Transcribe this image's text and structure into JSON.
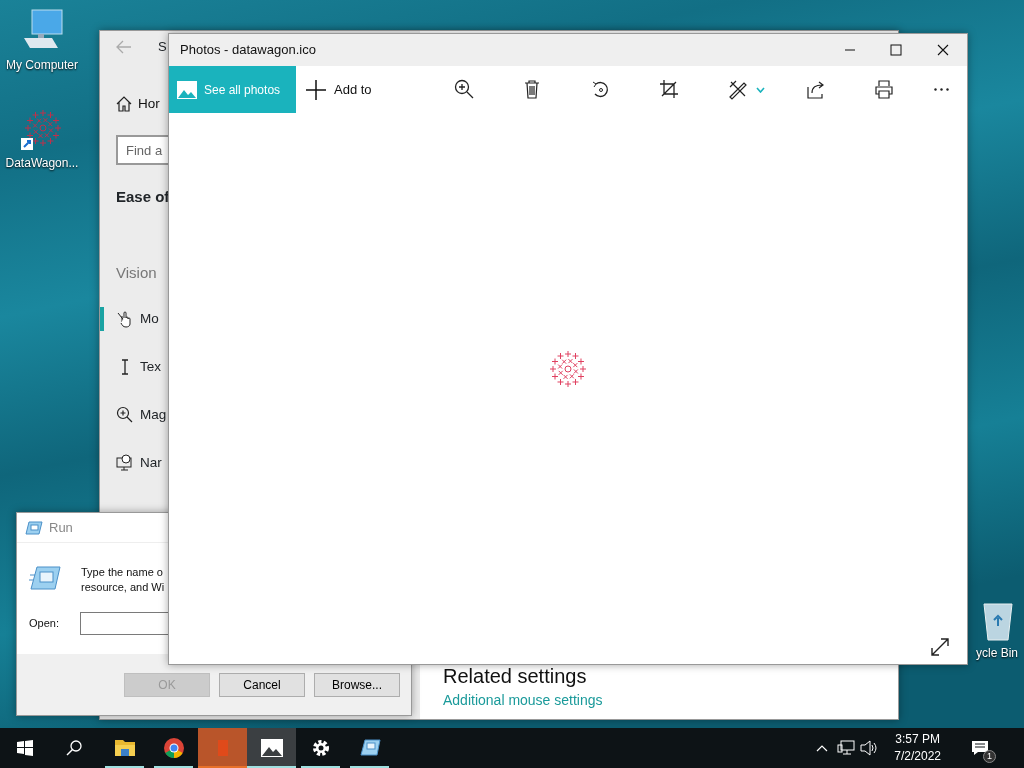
{
  "desktop_icons": [
    {
      "label": "My Computer",
      "kind": "computer"
    },
    {
      "label": "DataWagon...",
      "kind": "shortcut"
    },
    {
      "label": "ycle Bin",
      "kind": "recycle"
    }
  ],
  "settings_window": {
    "title": "S",
    "home": "Hor",
    "search": {
      "placeholder": "Find a"
    },
    "heading": "Ease of",
    "section": "Vision",
    "items": [
      {
        "label": "Mo",
        "kind": "mouse",
        "selected": true
      },
      {
        "label": "Tex",
        "kind": "text-cursor",
        "selected": false
      },
      {
        "label": "Mag",
        "kind": "magnifier",
        "selected": false
      },
      {
        "label": "Nar",
        "kind": "narrator",
        "selected": false
      }
    ],
    "related_heading": "Related settings",
    "related_link": "Additional mouse settings"
  },
  "run_dialog": {
    "title": "Run",
    "description": [
      "Type the name o",
      "resource, and Wi"
    ],
    "open_label": "Open:",
    "buttons": [
      {
        "label": "OK",
        "disabled": true
      },
      {
        "label": "Cancel",
        "disabled": false
      },
      {
        "label": "Browse...",
        "disabled": false
      }
    ]
  },
  "photos_window": {
    "title": "Photos - datawagon.ico",
    "see_all": "See all photos",
    "add_to": "Add to"
  },
  "taskbar": {
    "apps": [
      {
        "kind": "explorer",
        "running": true,
        "selected": false,
        "hovered": false
      },
      {
        "kind": "chrome",
        "running": true,
        "selected": false,
        "hovered": false
      },
      {
        "kind": "office",
        "running": true,
        "selected": false,
        "hovered": true
      },
      {
        "kind": "photos",
        "running": true,
        "selected": true,
        "hovered": false
      },
      {
        "kind": "settings",
        "running": true,
        "selected": false,
        "hovered": false
      },
      {
        "kind": "run",
        "running": true,
        "selected": false,
        "hovered": false
      }
    ],
    "time": "3:57 PM",
    "date": "7/2/2022",
    "notification_count": "1"
  }
}
